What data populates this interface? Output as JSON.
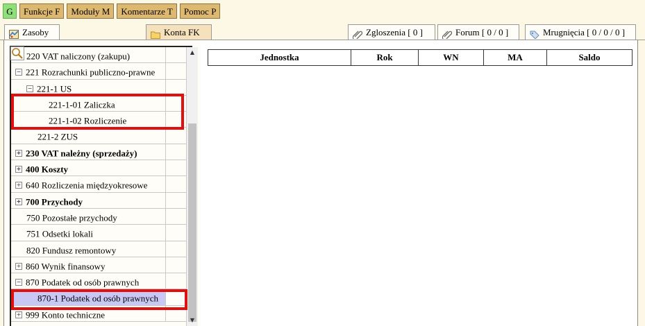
{
  "topbar": {
    "buttons": [
      {
        "label": "G"
      },
      {
        "label": "Funkcje F"
      },
      {
        "label": "Moduły M"
      },
      {
        "label": "Komentarze T"
      },
      {
        "label": "Pomoc P"
      }
    ]
  },
  "tabs": {
    "left": [
      {
        "label": "Zasoby",
        "icon": "map-icon"
      },
      {
        "label": "Konta FK",
        "icon": "folder-icon",
        "active": true
      }
    ],
    "right": [
      {
        "label": "Zgloszenia [ 0 ]",
        "icon": "paperclip-icon"
      },
      {
        "label": "Forum [ 0 / 0 ]",
        "icon": "paperclip-icon"
      },
      {
        "label": "Mrugnięcia [ 0 / 0 / 0 ]",
        "icon": "tag-icon"
      }
    ]
  },
  "tree": {
    "rows": [
      {
        "label": "220 VAT naliczony (zakupu)",
        "expander": "",
        "bold": false
      },
      {
        "label": "221 Rozrachunki publiczno-prawne",
        "expander": "−",
        "bold": false
      },
      {
        "label": "221-1 US",
        "expander": "−",
        "bold": false
      },
      {
        "label": "221-1-01 Zaliczka",
        "expander": "",
        "bold": false
      },
      {
        "label": "221-1-02 Rozliczenie",
        "expander": "",
        "bold": false
      },
      {
        "label": "221-2 ZUS",
        "expander": "",
        "bold": false
      },
      {
        "label": "230 VAT należny (sprzedaży)",
        "expander": "+",
        "bold": true
      },
      {
        "label": "400 Koszty",
        "expander": "+",
        "bold": true
      },
      {
        "label": "640 Rozliczenia międzyokresowe",
        "expander": "+",
        "bold": false
      },
      {
        "label": "700 Przychody",
        "expander": "+",
        "bold": true
      },
      {
        "label": "750 Pozostałe przychody",
        "expander": "",
        "bold": false
      },
      {
        "label": "751 Odsetki lokali",
        "expander": "",
        "bold": false
      },
      {
        "label": "820 Fundusz remontowy",
        "expander": "",
        "bold": false
      },
      {
        "label": "860 Wynik finansowy",
        "expander": "+",
        "bold": false
      },
      {
        "label": "870 Podatek od osób prawnych",
        "expander": "−",
        "bold": false
      },
      {
        "label": "870-1 Podatek od osób prawnych",
        "expander": "",
        "bold": false,
        "selected": true
      },
      {
        "label": "999 Konto techniczne",
        "expander": "+",
        "bold": false
      }
    ]
  },
  "grid": {
    "columns": [
      "Jednostka",
      "Rok",
      "WN",
      "MA",
      "Saldo"
    ]
  },
  "colors": {
    "highlight_box": "#e01010",
    "selected_row": "#c9c8f4",
    "menu_button": "#dcb870"
  }
}
